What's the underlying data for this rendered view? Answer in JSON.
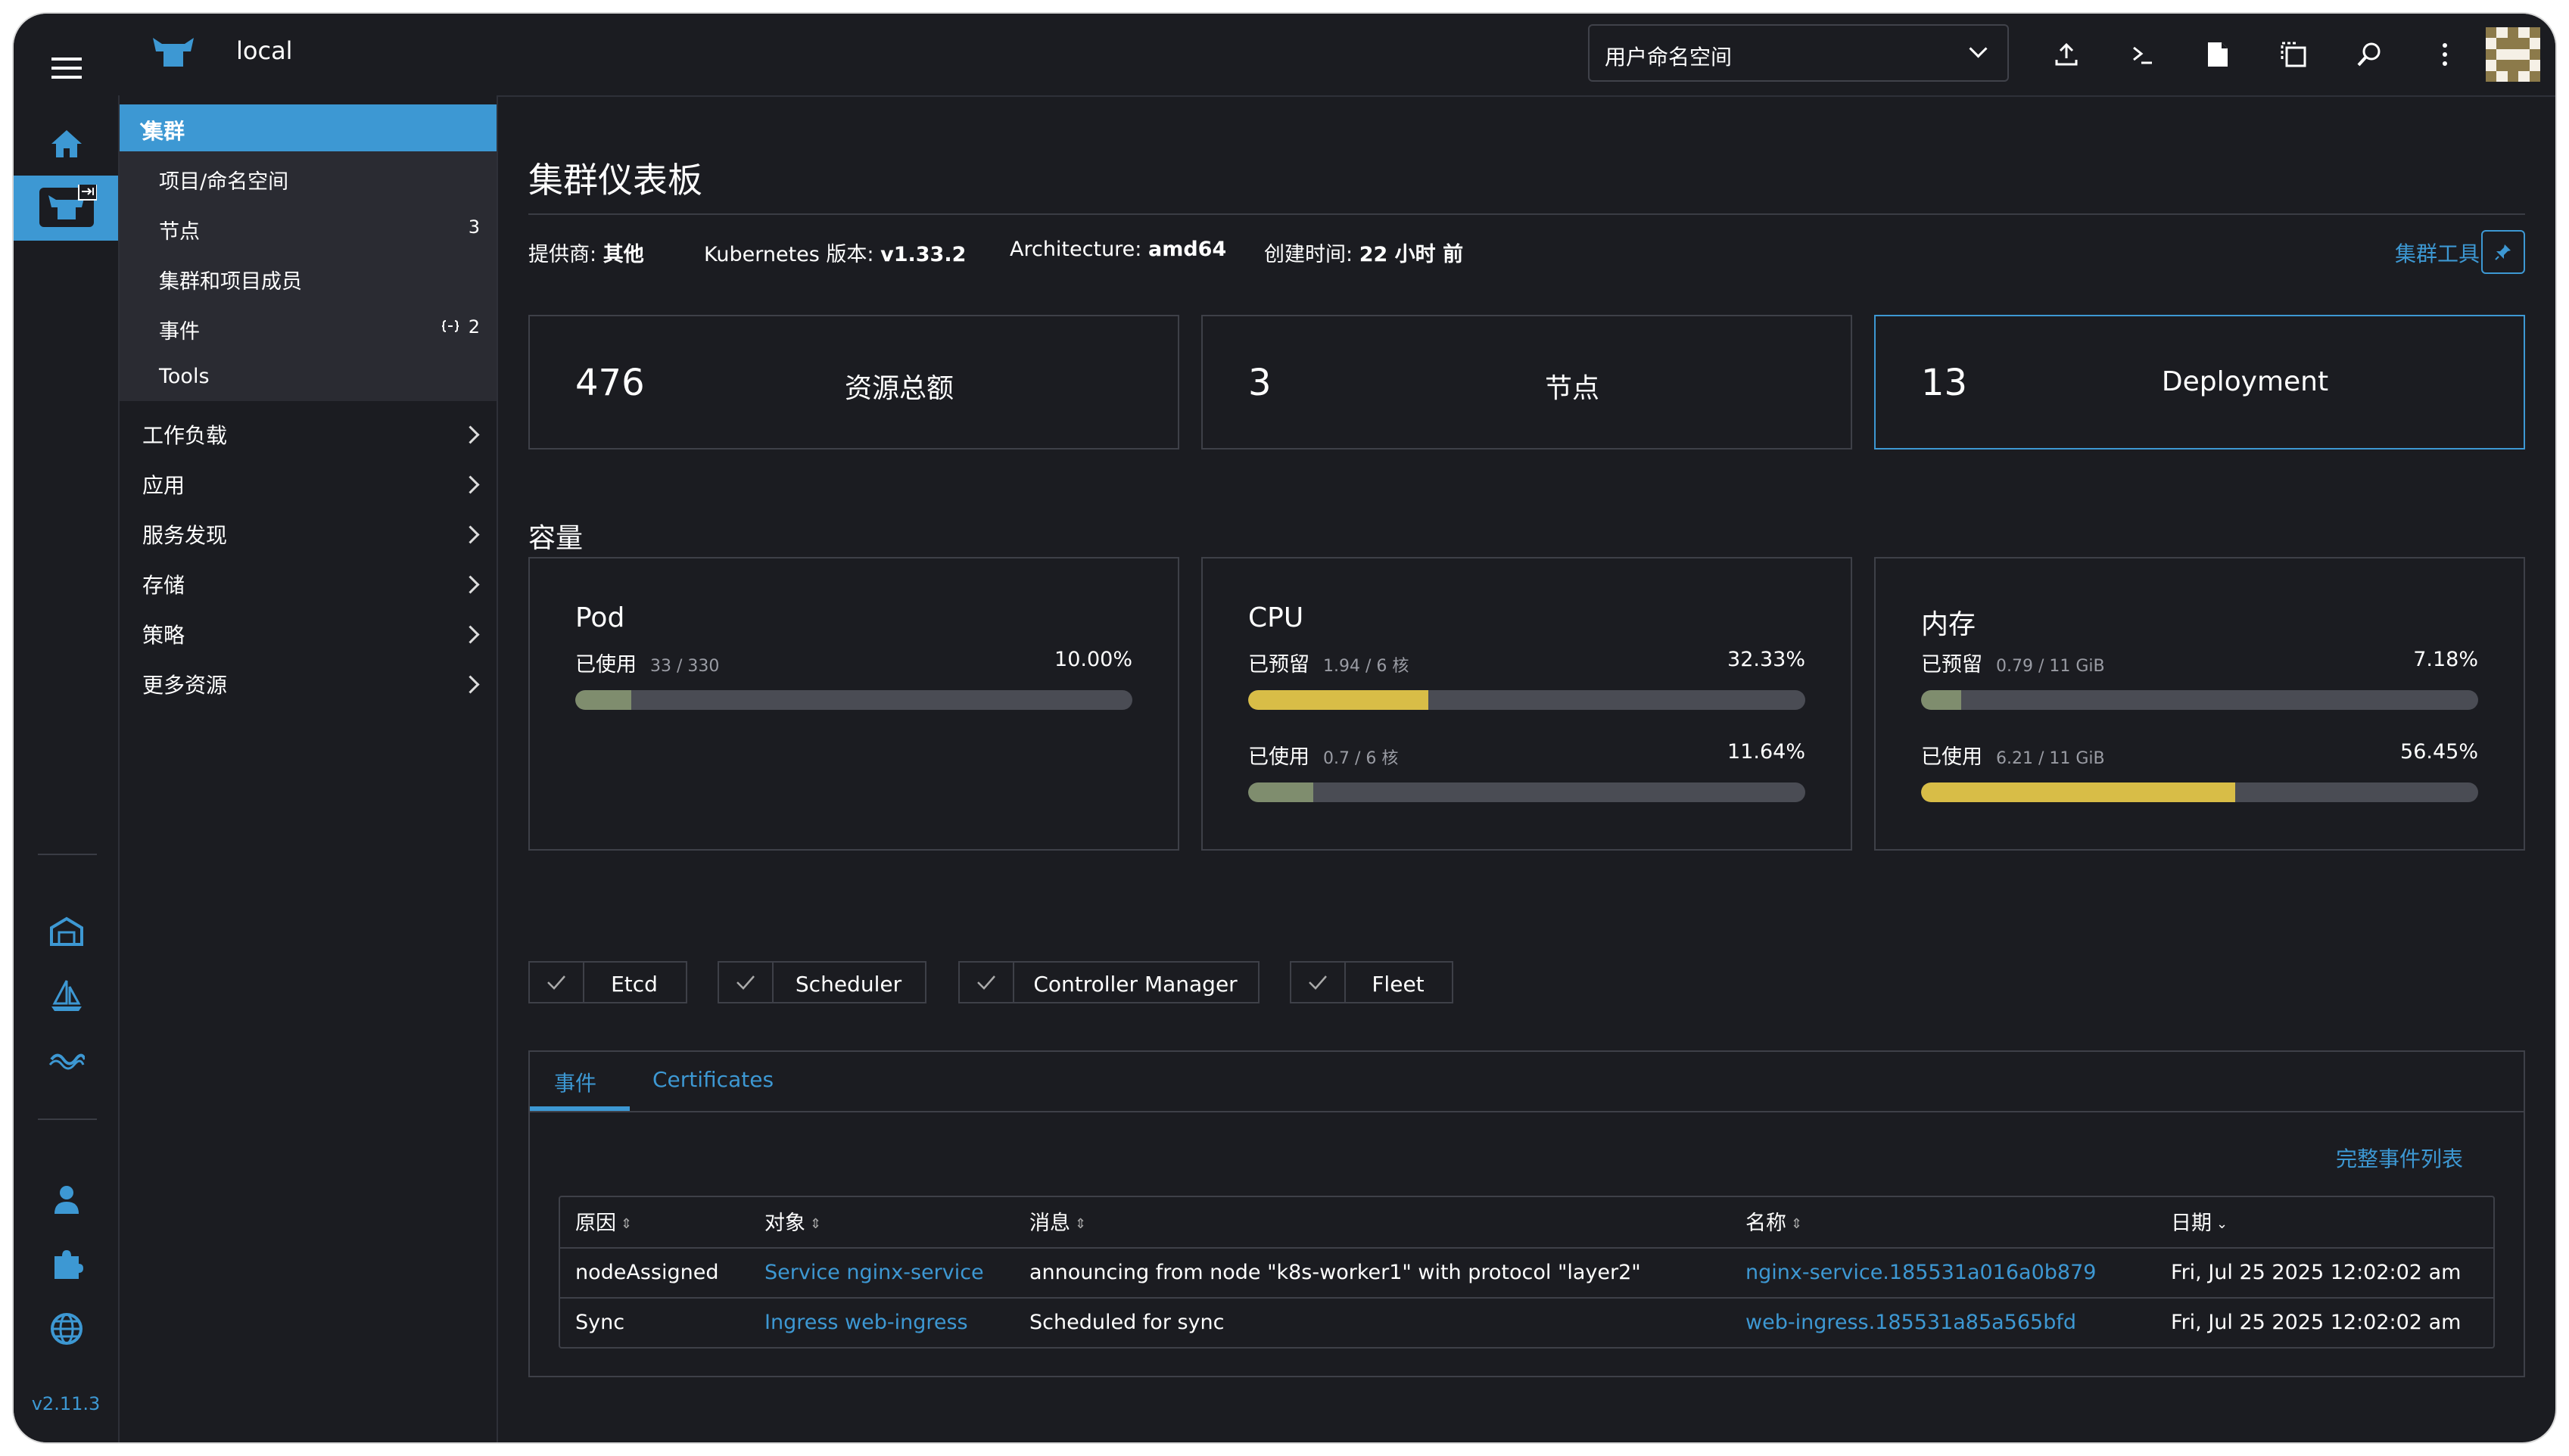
{
  "rail": {
    "version": "v2.11.3"
  },
  "header": {
    "cluster_name": "local",
    "namespace_select": "用户命名空间"
  },
  "sidenav": {
    "group_title": "集群",
    "sub_items": [
      {
        "label": "项目/命名空间",
        "count": ""
      },
      {
        "label": "节点",
        "count": "3"
      },
      {
        "label": "集群和项目成员",
        "count": ""
      },
      {
        "label": "事件",
        "count": "2"
      },
      {
        "label": "Tools",
        "count": ""
      }
    ],
    "items": [
      "工作负载",
      "应用",
      "服务发现",
      "存储",
      "策略",
      "更多资源"
    ]
  },
  "main": {
    "title": "集群仪表板",
    "meta": {
      "provider_label": "提供商:",
      "provider_value": "其他",
      "k8s_label": "Kubernetes 版本:",
      "k8s_value": "v1.33.2",
      "arch_label": "Architecture:",
      "arch_value": "amd64",
      "created_label": "创建时间:",
      "created_value": "22 小时 前"
    },
    "cluster_tools": "集群工具",
    "stats": [
      {
        "num": "476",
        "label": "资源总额"
      },
      {
        "num": "3",
        "label": "节点"
      },
      {
        "num": "13",
        "label": "Deployment"
      }
    ],
    "capacity_title": "容量",
    "capacity": {
      "pod": {
        "title": "Pod",
        "used_label": "已使用",
        "used_detail": "33 / 330",
        "used_pct": "10.00%",
        "used_value": 10.0
      },
      "cpu": {
        "title": "CPU",
        "reserved_label": "已预留",
        "reserved_detail": "1.94 / 6 核",
        "reserved_pct": "32.33%",
        "reserved_value": 32.33,
        "used_label": "已使用",
        "used_detail": "0.7 / 6 核",
        "used_pct": "11.64%",
        "used_value": 11.64
      },
      "memory": {
        "title": "内存",
        "reserved_label": "已预留",
        "reserved_detail": "0.79 / 11 GiB",
        "reserved_pct": "7.18%",
        "reserved_value": 7.18,
        "used_label": "已使用",
        "used_detail": "6.21 / 11 GiB",
        "used_pct": "56.45%",
        "used_value": 56.45
      }
    },
    "components": [
      "Etcd",
      "Scheduler",
      "Controller Manager",
      "Fleet"
    ],
    "tabs": {
      "events": "事件",
      "certificates": "Certificates"
    },
    "full_events_link": "完整事件列表",
    "table": {
      "headers": {
        "reason": "原因",
        "object": "对象",
        "message": "消息",
        "name": "名称",
        "date": "日期"
      },
      "rows": [
        {
          "reason": "nodeAssigned",
          "object": "Service nginx-service",
          "message": "announcing from node \"k8s-worker1\" with protocol \"layer2\"",
          "name": "nginx-service.185531a016a0b879",
          "date": "Fri, Jul 25 2025  12:02:02 am"
        },
        {
          "reason": "Sync",
          "object": "Ingress web-ingress",
          "message": "Scheduled for sync",
          "name": "web-ingress.185531a85a565bfd",
          "date": "Fri, Jul 25 2025  12:02:02 am"
        }
      ]
    }
  },
  "colors": {
    "accent": "#3d98d3",
    "bar_green": "#7f8d6e",
    "bar_yellow": "#d8bd47",
    "track": "#4a4c54"
  }
}
